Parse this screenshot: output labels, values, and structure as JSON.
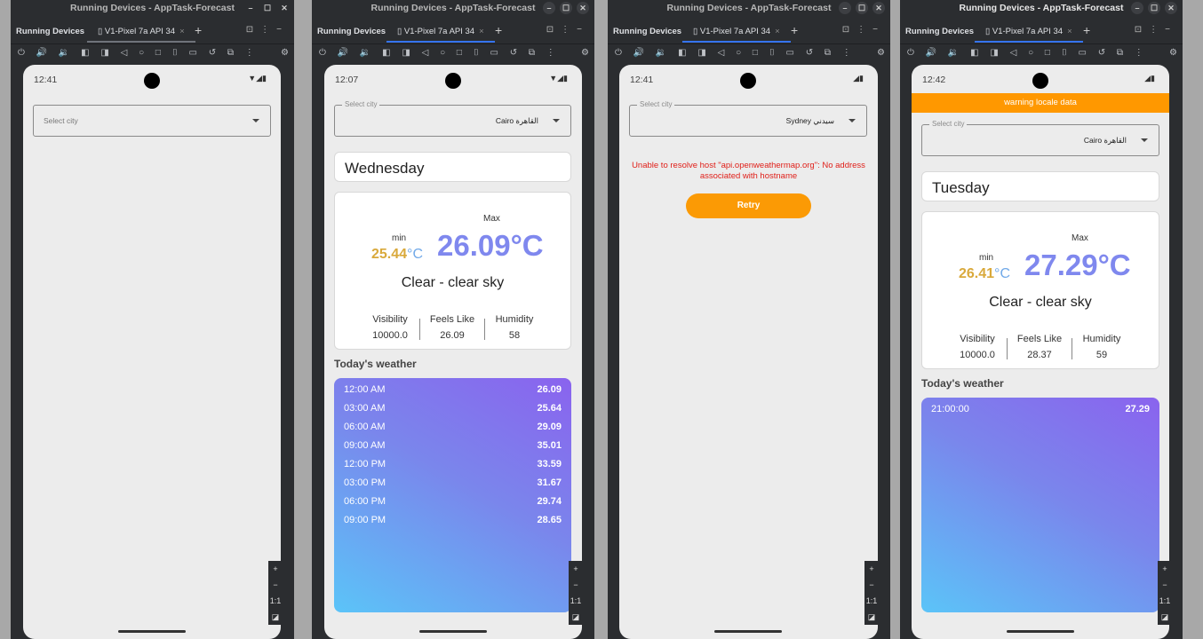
{
  "window_title": "Running Devices - AppTask-Forecast",
  "running_devices_label": "Running Devices",
  "device_tab_label": "V1-Pixel 7a API 34",
  "zoom_controls": {
    "plus": "+",
    "minus": "−",
    "fit": "1:1"
  },
  "panels": [
    {
      "time": "12:41",
      "select_placeholder": "Select city"
    },
    {
      "time": "12:07",
      "select_label": "Select city",
      "select_value": "Cairo القاهرة",
      "day": "Wednesday",
      "max_label": "Max",
      "min_label": "min",
      "min_temp": "25.44",
      "min_unit": "°C",
      "max_temp": "26.09°C",
      "description": "Clear - clear sky",
      "stats": [
        {
          "label": "Visibility",
          "value": "10000.0"
        },
        {
          "label": "Feels Like",
          "value": "26.09"
        },
        {
          "label": "Humidity",
          "value": "58"
        }
      ],
      "today_heading": "Today's weather",
      "hourly": [
        {
          "time": "12:00 AM",
          "temp": "26.09"
        },
        {
          "time": "03:00 AM",
          "temp": "25.64"
        },
        {
          "time": "06:00 AM",
          "temp": "29.09"
        },
        {
          "time": "09:00 AM",
          "temp": "35.01"
        },
        {
          "time": "12:00 PM",
          "temp": "33.59"
        },
        {
          "time": "03:00 PM",
          "temp": "31.67"
        },
        {
          "time": "06:00 PM",
          "temp": "29.74"
        },
        {
          "time": "09:00 PM",
          "temp": "28.65"
        }
      ]
    },
    {
      "time": "12:41",
      "select_label": "Select city",
      "select_value": "Sydney سيدني",
      "error": "Unable to resolve host \"api.openweathermap.org\": No address associated with hostname",
      "retry_label": "Retry"
    },
    {
      "time": "12:42",
      "warning": "warning locale data",
      "select_label": "Select city",
      "select_value": "Cairo القاهرة",
      "day": "Tuesday",
      "max_label": "Max",
      "min_label": "min",
      "min_temp": "26.41",
      "min_unit": "°C",
      "max_temp": "27.29°C",
      "description": "Clear - clear sky",
      "stats": [
        {
          "label": "Visibility",
          "value": "10000.0"
        },
        {
          "label": "Feels Like",
          "value": "28.37"
        },
        {
          "label": "Humidity",
          "value": "59"
        }
      ],
      "today_heading": "Today's weather",
      "hourly": [
        {
          "time": "21:00:00",
          "temp": "27.29"
        }
      ]
    }
  ]
}
